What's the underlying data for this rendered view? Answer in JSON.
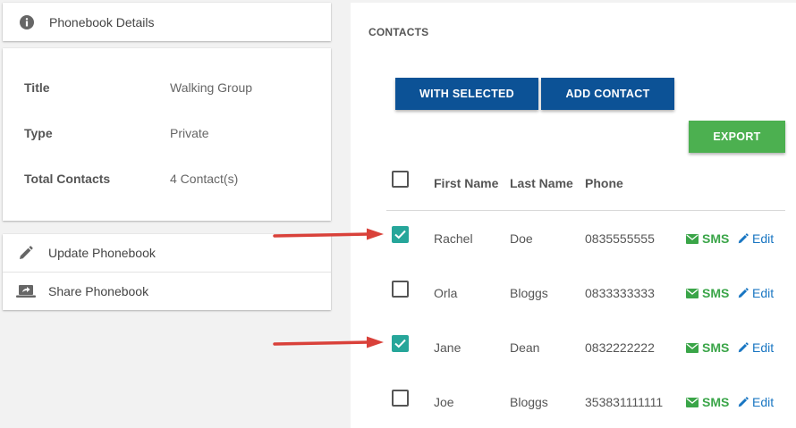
{
  "sidebar": {
    "header": {
      "title": "Phonebook Details",
      "icon": "info-icon"
    },
    "details": [
      {
        "label": "Title",
        "value": "Walking Group"
      },
      {
        "label": "Type",
        "value": "Private"
      },
      {
        "label": "Total Contacts",
        "value": "4 Contact(s)"
      }
    ],
    "actions": [
      {
        "label": "Update Phonebook",
        "icon": "pencil-icon"
      },
      {
        "label": "Share Phonebook",
        "icon": "laptop-share-icon"
      }
    ]
  },
  "contacts": {
    "title": "CONTACTS",
    "buttons": {
      "with_selected": "WITH SELECTED",
      "add_contact": "ADD CONTACT",
      "export": "EXPORT"
    },
    "columns": [
      "First Name",
      "Last Name",
      "Phone"
    ],
    "rows": [
      {
        "first": "Rachel",
        "last": "Doe",
        "phone": "0835555555",
        "checked": true,
        "sms": "SMS",
        "edit": "Edit"
      },
      {
        "first": "Orla",
        "last": "Bloggs",
        "phone": "0833333333",
        "checked": false,
        "sms": "SMS",
        "edit": "Edit"
      },
      {
        "first": "Jane",
        "last": "Dean",
        "phone": "0832222222",
        "checked": true,
        "sms": "SMS",
        "edit": "Edit"
      },
      {
        "first": "Joe",
        "last": "Bloggs",
        "phone": "353831111111",
        "checked": false,
        "sms": "SMS",
        "edit": "Edit"
      }
    ]
  },
  "colors": {
    "primary_button": "#0c5296",
    "export_button": "#4cb050",
    "checkbox_checked": "#26a69a",
    "sms_link": "#3aa548",
    "edit_link": "#1976c2",
    "annotation_arrow": "#d9413a"
  }
}
